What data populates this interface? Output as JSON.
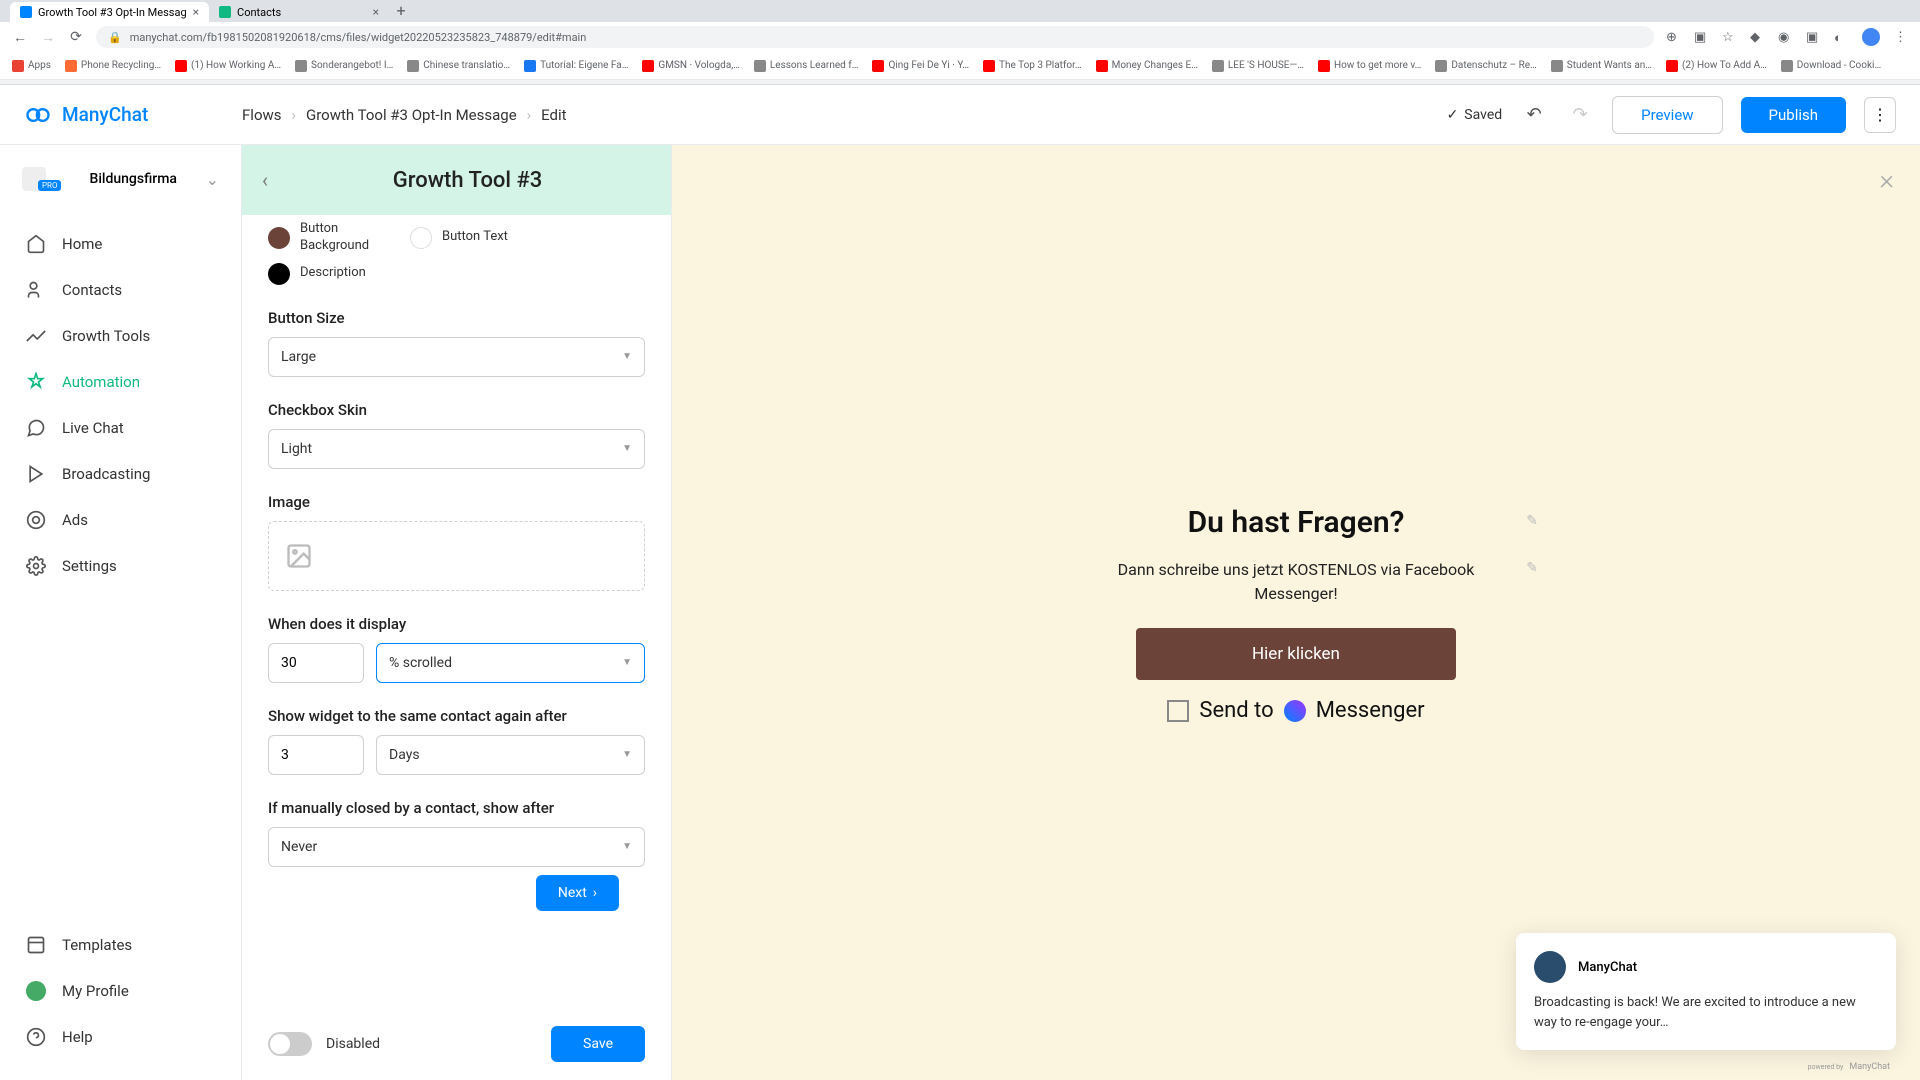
{
  "browser": {
    "tabs": [
      {
        "title": "Growth Tool #3 Opt-In Messag",
        "active": true
      },
      {
        "title": "Contacts",
        "active": false
      }
    ],
    "url": "manychat.com/fb198150208192061​8/cms/files/widget20220523235823_748879/edit#main",
    "bookmarks": [
      "Apps",
      "Phone Recycling…",
      "(1) How Working A…",
      "Sonderangebot! I…",
      "Chinese translatio…",
      "Tutorial: Eigene Fa…",
      "GMSN · Vologda,…",
      "Lessons Learned f…",
      "Qing Fei De Yi · Y…",
      "The Top 3 Platfor…",
      "Money Changes E…",
      "LEE 'S HOUSE—…",
      "How to get more v…",
      "Datenschutz – Re…",
      "Student Wants an…",
      "(2) How To Add A…",
      "Download - Cooki…"
    ]
  },
  "logo": "ManyChat",
  "breadcrumbs": [
    "Flows",
    "Growth Tool #3 Opt-In Message",
    "Edit"
  ],
  "saved": "Saved",
  "preview": "Preview",
  "publish": "Publish",
  "org": {
    "name": "Bildungsfirma",
    "badge": "PRO"
  },
  "nav": {
    "home": "Home",
    "contacts": "Contacts",
    "growth": "Growth Tools",
    "automation": "Automation",
    "livechat": "Live Chat",
    "broadcasting": "Broadcasting",
    "ads": "Ads",
    "settings": "Settings",
    "templates": "Templates",
    "profile": "My Profile",
    "help": "Help"
  },
  "panel": {
    "title": "Growth Tool #3",
    "colors": {
      "btn_bg": "Button Background",
      "btn_text": "Button Text",
      "desc": "Description"
    },
    "button_size_lbl": "Button Size",
    "button_size_val": "Large",
    "checkbox_lbl": "Checkbox Skin",
    "checkbox_val": "Light",
    "image_lbl": "Image",
    "display_lbl": "When does it display",
    "display_val": "30",
    "display_unit": "% scrolled",
    "again_lbl": "Show widget to the same contact again after",
    "again_val": "3",
    "again_unit": "Days",
    "manual_lbl": "If manually closed by a contact, show after",
    "manual_val": "Never",
    "next": "Next",
    "disabled": "Disabled",
    "save": "Save"
  },
  "widget": {
    "title": "Du hast Fragen?",
    "desc": "Dann schreibe uns jetzt KOSTENLOS via Facebook Messenger!",
    "button": "Hier klicken",
    "send_pre": "Send to",
    "send_post": "Messenger"
  },
  "notif": {
    "name": "ManyChat",
    "body": "Broadcasting is back! We are excited to introduce a new way to re-engage your…",
    "brand": "ManyChat"
  }
}
